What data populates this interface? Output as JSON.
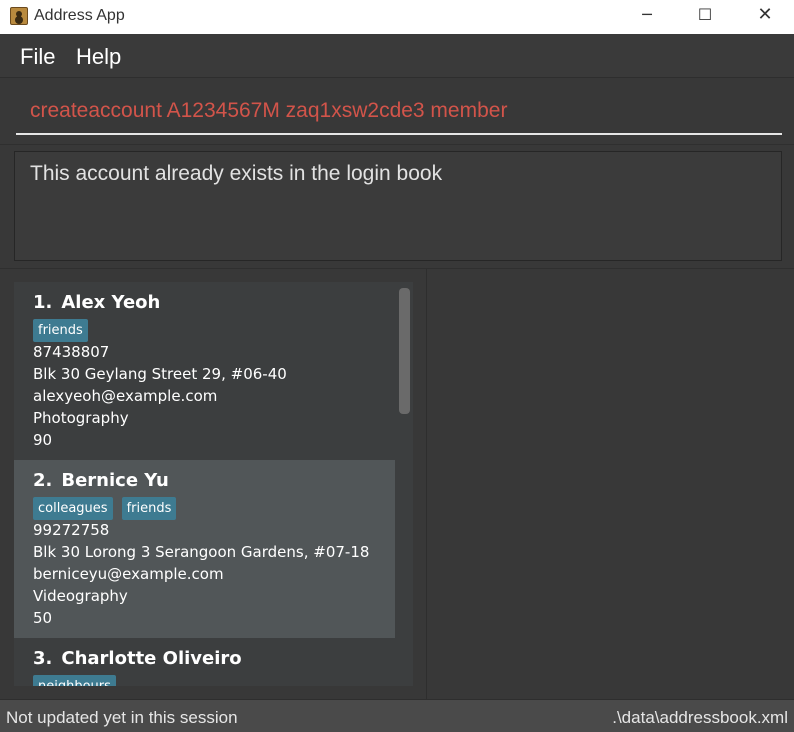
{
  "window": {
    "title": "Address App",
    "minimize_glyph": "─",
    "maximize_glyph": "☐",
    "close_glyph": "✕"
  },
  "menu": {
    "file": "File",
    "help": "Help"
  },
  "command": {
    "value": "createaccount A1234567M zaq1xsw2cde3 member",
    "text_color": "#d2544a"
  },
  "result": {
    "message": "This account already exists in the login book"
  },
  "persons": [
    {
      "index": "1.",
      "name": "Alex Yeoh",
      "tags": [
        "friends"
      ],
      "phone": "87438807",
      "address": "Blk 30 Geylang Street 29, #06-40",
      "email": "alexyeoh@example.com",
      "interest": "Photography",
      "score": "90"
    },
    {
      "index": "2.",
      "name": "Bernice Yu",
      "tags": [
        "colleagues",
        "friends"
      ],
      "phone": "99272758",
      "address": "Blk 30 Lorong 3 Serangoon Gardens, #07-18",
      "email": "berniceyu@example.com",
      "interest": "Videography",
      "score": "50",
      "selected": true
    },
    {
      "index": "3.",
      "name": "Charlotte Oliveiro",
      "tags": [
        "neighbours"
      ]
    }
  ],
  "status": {
    "sync": "Not updated yet in this session",
    "file_path": ".\\data\\addressbook.xml"
  },
  "colors": {
    "background": "#383838",
    "tag": "#3e7b91",
    "selected_card": "#515658",
    "command_text": "#d2544a"
  }
}
